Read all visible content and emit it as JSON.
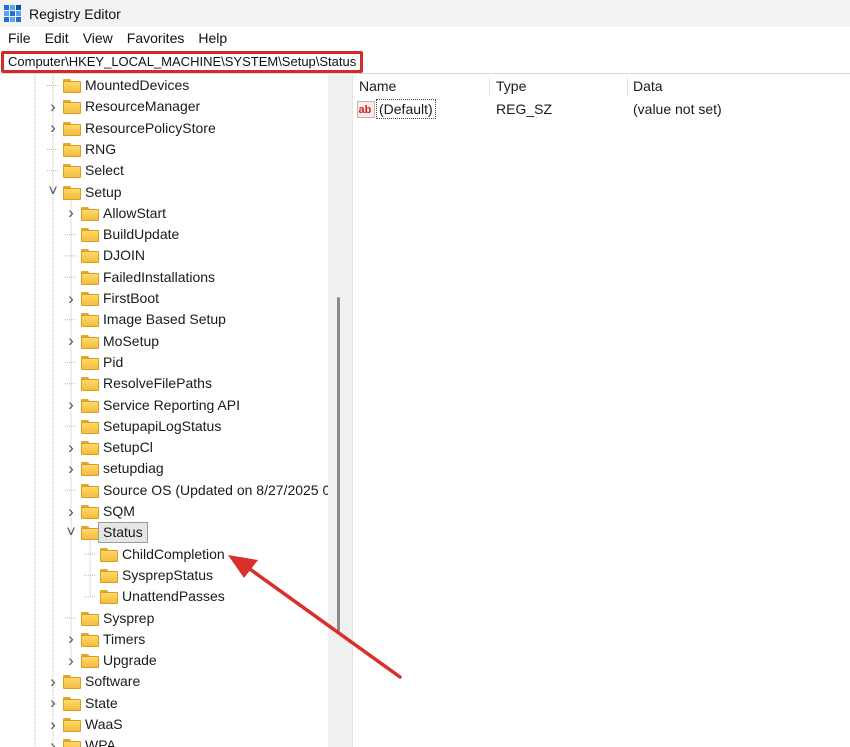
{
  "window": {
    "title": "Registry Editor"
  },
  "menu": {
    "items": [
      "File",
      "Edit",
      "View",
      "Favorites",
      "Help"
    ]
  },
  "address": {
    "path": "Computer\\HKEY_LOCAL_MACHINE\\SYSTEM\\Setup\\Status",
    "highlight_color": "#d42a2a"
  },
  "tree": {
    "items": [
      {
        "label": "MountedDevices",
        "level": 2,
        "expander": "none"
      },
      {
        "label": "ResourceManager",
        "level": 2,
        "expander": "collapsed"
      },
      {
        "label": "ResourcePolicyStore",
        "level": 2,
        "expander": "collapsed"
      },
      {
        "label": "RNG",
        "level": 2,
        "expander": "none"
      },
      {
        "label": "Select",
        "level": 2,
        "expander": "none"
      },
      {
        "label": "Setup",
        "level": 2,
        "expander": "expanded"
      },
      {
        "label": "AllowStart",
        "level": 3,
        "expander": "collapsed"
      },
      {
        "label": "BuildUpdate",
        "level": 3,
        "expander": "none"
      },
      {
        "label": "DJOIN",
        "level": 3,
        "expander": "none"
      },
      {
        "label": "FailedInstallations",
        "level": 3,
        "expander": "none"
      },
      {
        "label": "FirstBoot",
        "level": 3,
        "expander": "collapsed"
      },
      {
        "label": "Image Based Setup",
        "level": 3,
        "expander": "none"
      },
      {
        "label": "MoSetup",
        "level": 3,
        "expander": "collapsed"
      },
      {
        "label": "Pid",
        "level": 3,
        "expander": "none"
      },
      {
        "label": "ResolveFilePaths",
        "level": 3,
        "expander": "none"
      },
      {
        "label": "Service Reporting API",
        "level": 3,
        "expander": "collapsed"
      },
      {
        "label": "SetupapiLogStatus",
        "level": 3,
        "expander": "none"
      },
      {
        "label": "SetupCl",
        "level": 3,
        "expander": "collapsed"
      },
      {
        "label": "setupdiag",
        "level": 3,
        "expander": "collapsed"
      },
      {
        "label": "Source OS (Updated on 8/27/2025 0",
        "level": 3,
        "expander": "none"
      },
      {
        "label": "SQM",
        "level": 3,
        "expander": "collapsed"
      },
      {
        "label": "Status",
        "level": 3,
        "expander": "expanded",
        "selected": true
      },
      {
        "label": "ChildCompletion",
        "level": 4,
        "expander": "none"
      },
      {
        "label": "SysprepStatus",
        "level": 4,
        "expander": "none"
      },
      {
        "label": "UnattendPasses",
        "level": 4,
        "expander": "none"
      },
      {
        "label": "Sysprep",
        "level": 3,
        "expander": "none"
      },
      {
        "label": "Timers",
        "level": 3,
        "expander": "collapsed"
      },
      {
        "label": "Upgrade",
        "level": 3,
        "expander": "collapsed"
      },
      {
        "label": "Software",
        "level": 2,
        "expander": "collapsed"
      },
      {
        "label": "State",
        "level": 2,
        "expander": "collapsed"
      },
      {
        "label": "WaaS",
        "level": 2,
        "expander": "collapsed"
      },
      {
        "label": "WPA",
        "level": 2,
        "expander": "collapsed"
      }
    ]
  },
  "values": {
    "columns": {
      "name": "Name",
      "type": "Type",
      "data": "Data"
    },
    "rows": [
      {
        "name": "(Default)",
        "type": "REG_SZ",
        "data": "(value not set)",
        "icon": "string-value-icon"
      }
    ]
  },
  "annotation": {
    "arrow_color": "#d9302c",
    "target": "ChildCompletion"
  }
}
